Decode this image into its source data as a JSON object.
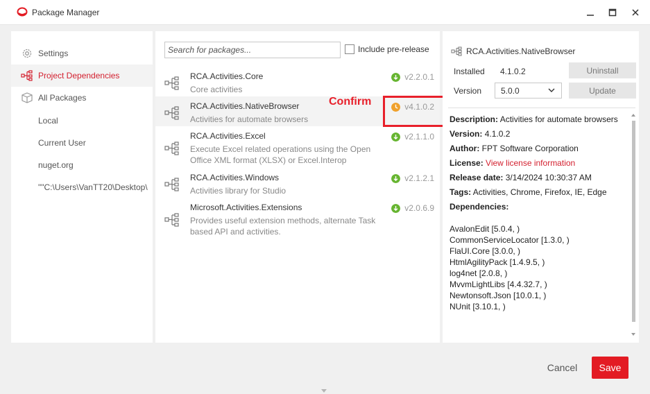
{
  "window": {
    "title": "Package Manager",
    "accent_color": "#e31b23",
    "controls": [
      "minimize-icon",
      "maximize-icon",
      "close-icon"
    ]
  },
  "sidebar": {
    "items": [
      {
        "label": "Settings",
        "icon": "gear-icon",
        "active": false
      },
      {
        "label": "Project Dependencies",
        "icon": "dependency-tree-icon",
        "active": true
      },
      {
        "label": "All Packages",
        "icon": "package-box-icon",
        "active": false
      }
    ],
    "sources": [
      "Local",
      "Current User",
      "nuget.org",
      "\"\"C:\\Users\\VanTT20\\Desktop\\"
    ]
  },
  "search": {
    "placeholder": "Search for packages...",
    "value": ""
  },
  "prerelease": {
    "label": "Include pre-release",
    "checked": false
  },
  "packages": [
    {
      "name": "RCA.Activities.Core",
      "description": "Core activities",
      "version": "v2.2.0.1",
      "status": "download",
      "selected": false
    },
    {
      "name": "RCA.Activities.NativeBrowser",
      "description": "Activities for automate browsers",
      "version": "v4.1.0.2",
      "status": "pending",
      "selected": true
    },
    {
      "name": "RCA.Activities.Excel",
      "description": "Execute Excel related operations using the Open Office XML format (XLSX) or Excel.Interop",
      "version": "v2.1.1.0",
      "status": "download",
      "selected": false
    },
    {
      "name": "RCA.Activities.Windows",
      "description": "Activities library for Studio",
      "version": "v2.1.2.1",
      "status": "download",
      "selected": false
    },
    {
      "name": "Microsoft.Activities.Extensions",
      "description": "Provides useful extension methods, alternate Task based API and activities.",
      "version": "v2.0.6.9",
      "status": "download",
      "selected": false
    }
  ],
  "annotation": {
    "label": "Confirm",
    "color": "#e8202b"
  },
  "detail": {
    "name": "RCA.Activities.NativeBrowser",
    "installed_label": "Installed",
    "installed_version": "4.1.0.2",
    "version_label": "Version",
    "version_selected": "5.0.0",
    "uninstall_label": "Uninstall",
    "update_label": "Update",
    "description_label": "Description:",
    "description": "Activities for automate browsers",
    "version_field_label": "Version:",
    "version_field": "4.1.0.2",
    "author_label": "Author:",
    "author": "FPT Software Corporation",
    "license_label": "License:",
    "license_link": "View license information",
    "release_label": "Release date:",
    "release_date": "3/14/2024 10:30:37 AM",
    "tags_label": "Tags:",
    "tags": "Activities, Chrome, Firefox, IE, Edge",
    "dependencies_label": "Dependencies:",
    "dependencies": [
      "AvalonEdit [5.0.4, )",
      "CommonServiceLocator [1.3.0, )",
      "FlaUI.Core [3.0.0, )",
      "HtmlAgilityPack [1.4.9.5, )",
      "log4net [2.0.8, )",
      "MvvmLightLibs [4.4.32.7, )",
      "Newtonsoft.Json [10.0.1, )",
      "NUnit [3.10.1, )"
    ]
  },
  "footer": {
    "cancel_label": "Cancel",
    "save_label": "Save"
  }
}
